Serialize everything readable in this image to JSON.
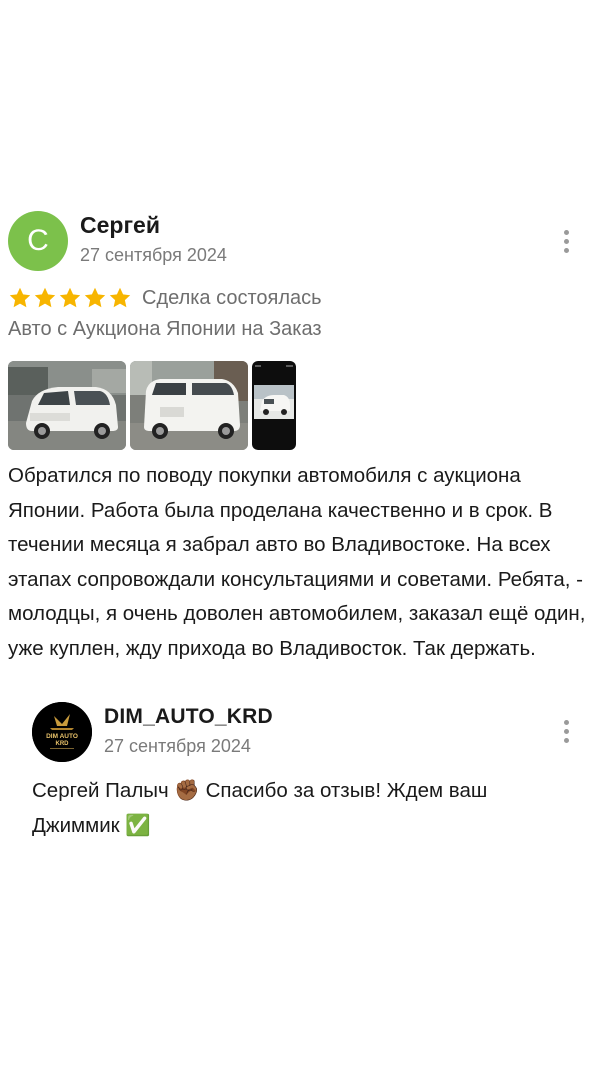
{
  "review": {
    "author": {
      "initial": "С",
      "name": "Сергей",
      "date": "27 сентября 2024",
      "avatar_color": "#7cc14b"
    },
    "rating": 5,
    "star_color": "#f7b500",
    "deal_status": "Сделка состоялась",
    "category": "Авто с Аукциона Японии на Заказ",
    "photos": [
      {
        "icon": "white-minivan-front-photo"
      },
      {
        "icon": "white-minivan-rear-photo"
      },
      {
        "icon": "phone-screenshot-car-photo"
      }
    ],
    "text": "Обратился по поводу покупки автомобиля с аукциона Японии. Работа была проделана качественно и в срок. В течении месяца я забрал авто во Владивостоке. На всех этапах сопровождали консультациями и советами. Ребята, - молодцы, я очень доволен автомобилем, заказал ещё один, уже куплен, жду прихода во Владивосток. Так держать.",
    "more_icon": "vertical-ellipsis-icon"
  },
  "reply": {
    "author": {
      "name": "DIM_AUTO_KRD",
      "date": "27 сентября 2024",
      "logo_text_line1": "DIM AUTO",
      "logo_text_line2": "KRD"
    },
    "text": "Сергей Палыч ✊🏾 Спасибо за отзыв! Ждем ваш Джиммик ✅",
    "more_icon": "vertical-ellipsis-icon"
  }
}
